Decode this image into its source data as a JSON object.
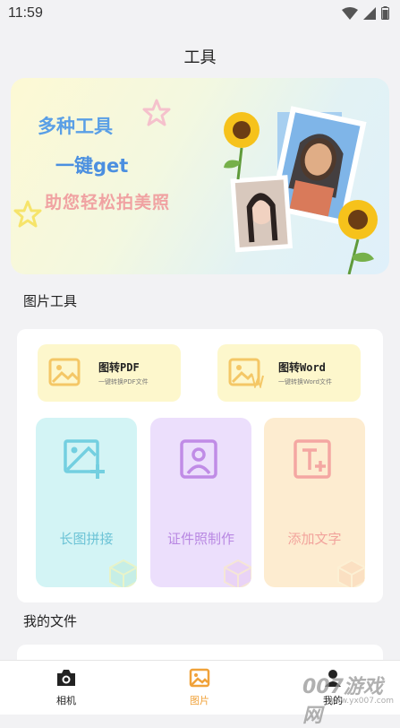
{
  "status_bar": {
    "time": "11:59"
  },
  "header": {
    "title": "工具"
  },
  "banner": {
    "line1": "多种工具",
    "line2": "一键get",
    "line3": "助您轻松拍美照"
  },
  "sections": {
    "image_tools": "图片工具",
    "my_files": "我的文件"
  },
  "converters": [
    {
      "title": "图转PDF",
      "subtitle": "一键转换PDF文件"
    },
    {
      "title": "图转Word",
      "subtitle": "一键转换Word文件"
    }
  ],
  "tiles": [
    {
      "label": "长图拼接"
    },
    {
      "label": "证件照制作"
    },
    {
      "label": "添加文字"
    }
  ],
  "nav": [
    {
      "label": "相机",
      "icon": "camera-icon"
    },
    {
      "label": "图片",
      "icon": "image-icon",
      "active": true
    },
    {
      "label": "我的",
      "icon": "person-icon"
    }
  ],
  "watermark": {
    "text": "007游戏网",
    "url": "www.yx007.com"
  },
  "colors": {
    "accent": "#f0a23a",
    "background": "#f2f2f4"
  }
}
